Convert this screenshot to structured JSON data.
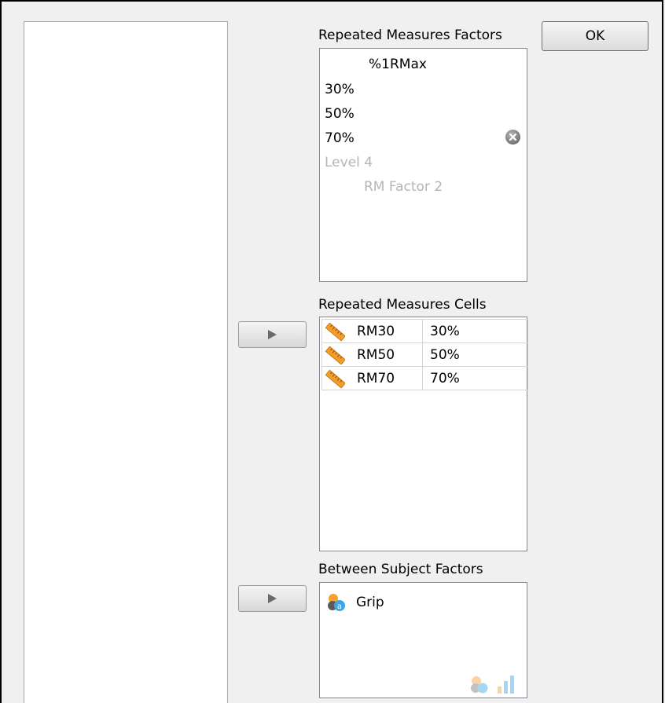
{
  "buttons": {
    "ok_label": "OK"
  },
  "rm_factors": {
    "label": "Repeated Measures Factors",
    "factor_name": "%1RMax",
    "levels": [
      "30%",
      "50%",
      "70%"
    ],
    "level_placeholder": "Level 4",
    "factor_placeholder": "RM Factor 2"
  },
  "rm_cells": {
    "label": "Repeated Measures Cells",
    "rows": [
      {
        "variable": "RM30",
        "level": "30%"
      },
      {
        "variable": "RM50",
        "level": "50%"
      },
      {
        "variable": "RM70",
        "level": "70%"
      }
    ]
  },
  "between_factors": {
    "label": "Between Subject Factors",
    "items": [
      "Grip"
    ]
  },
  "colors": {
    "ruler_orange": "#f39c2b",
    "nominal_orange": "#f5a031",
    "nominal_blue": "#3ea5e6"
  }
}
